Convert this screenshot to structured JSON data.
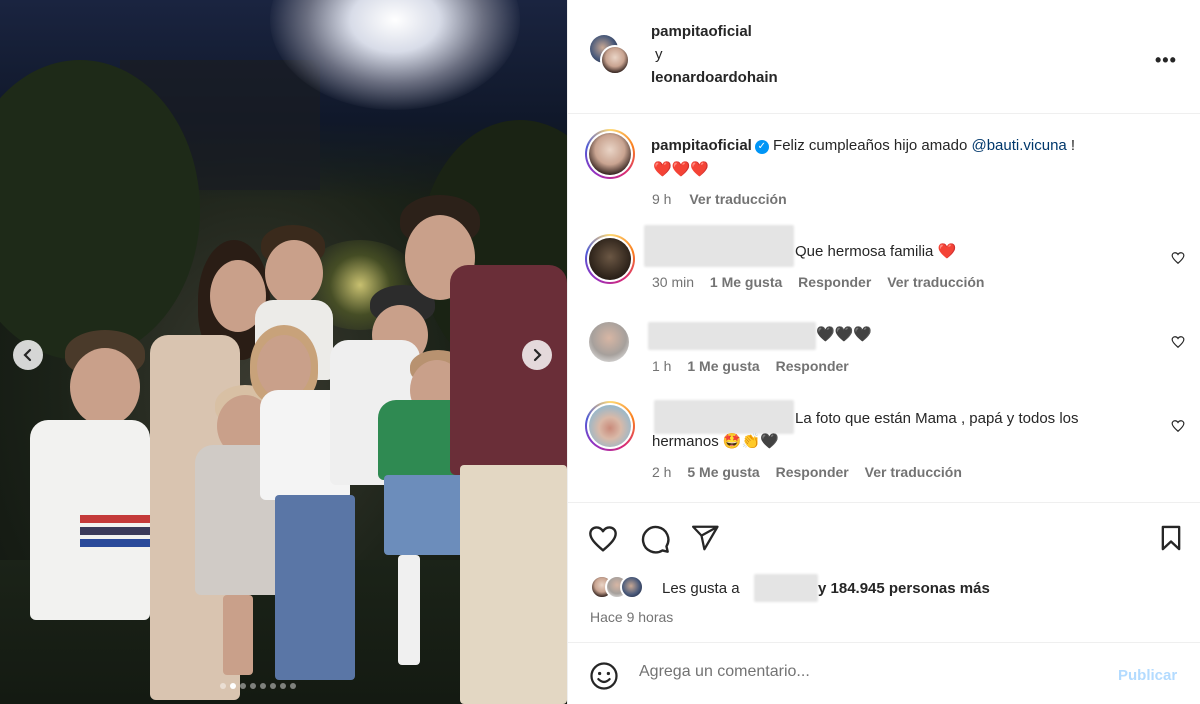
{
  "header": {
    "user1": "pampitaoficial",
    "connector": "y",
    "user2": "leonardoardohain",
    "more_icon": "more-horizontal-icon"
  },
  "caption": {
    "username": "pampitaoficial",
    "verified_icon": "verified-badge-icon",
    "text": "Feliz cumpleaños hijo amado ",
    "mention": "@bauti.vicuna",
    "end": " !",
    "hearts": "❤️❤️❤️",
    "time": "9 h",
    "translate": "Ver traducción"
  },
  "comments": [
    {
      "text": "Que hermosa familia",
      "emoji": "❤️",
      "time": "30 min",
      "likes": "1 Me gusta",
      "reply": "Responder",
      "translate": "Ver traducción"
    },
    {
      "text": "🖤🖤🖤",
      "time": "1 h",
      "likes": "1 Me gusta",
      "reply": "Responder"
    },
    {
      "text": "La foto que están Mama , papá y todos los",
      "text2": "hermanos 🤩👏🖤",
      "time": "2 h",
      "likes": "5 Me gusta",
      "reply": "Responder",
      "translate": "Ver traducción"
    }
  ],
  "actions": {
    "like_icon": "heart-icon",
    "comment_icon": "comment-icon",
    "share_icon": "send-icon",
    "save_icon": "bookmark-icon"
  },
  "likes": {
    "prefix": "Les gusta a",
    "suffix": "y 184.945 personas más"
  },
  "posted": "Hace 9 horas",
  "comment_box": {
    "emoji_icon": "emoji-icon",
    "placeholder": "Agrega un comentario...",
    "publish": "Publicar"
  },
  "carousel": {
    "prev_icon": "chevron-left-icon",
    "next_icon": "chevron-right-icon",
    "dots": 8,
    "active": 1
  },
  "colors": {
    "link": "#00376b",
    "publish_disabled": "#b3dbff",
    "verified": "#0095f6",
    "heart": "#ed4956"
  }
}
